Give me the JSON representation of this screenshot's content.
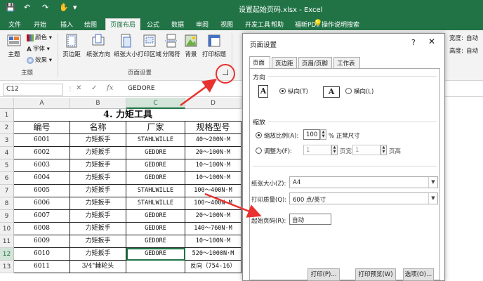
{
  "app": {
    "title": "设置起始页码.xlsx  -  Excel",
    "quick_access": [
      "💾",
      "↶",
      "↷",
      "✋",
      "▾"
    ]
  },
  "menu": {
    "tabs": [
      "文件",
      "开始",
      "插入",
      "绘图",
      "页面布局",
      "公式",
      "数据",
      "审阅",
      "视图",
      "开发工具",
      "帮助",
      "福昕PDF",
      "操作说明搜索"
    ],
    "active": "页面布局",
    "tell_me_icon": "lightbulb-icon"
  },
  "ribbon": {
    "theme_group": {
      "label": "主题",
      "main_button": "主题",
      "colors": "颜色",
      "fonts": "字体",
      "effects": "效果"
    },
    "page_setup_group": {
      "label": "页面设置",
      "buttons": [
        "页边距",
        "纸张方向",
        "纸张大小",
        "打印区域",
        "分隔符",
        "背景",
        "打印标题"
      ]
    },
    "scale_group": {
      "width_label": "宽度:",
      "width_value": "自动",
      "height_label": "高度:",
      "height_value": "自动"
    },
    "colors": {
      "accent": "#217346"
    }
  },
  "formula_bar": {
    "name_box": "C12",
    "cancel": "✕",
    "enter": "✓",
    "fx": "fx",
    "value": "GEDORE"
  },
  "sheet": {
    "columns": [
      "A",
      "B",
      "C",
      "D"
    ],
    "selected_column": "C",
    "row_numbers": [
      "1",
      "2",
      "3",
      "4",
      "5",
      "6",
      "7",
      "8",
      "9",
      "10",
      "11",
      "12",
      "13"
    ],
    "selected_row": "12",
    "title_cell": "4. 力矩工具",
    "headers": [
      "编号",
      "名称",
      "厂家",
      "规格型号"
    ],
    "rows": [
      [
        "6001",
        "力矩扳手",
        "STAHLWILLE",
        "40～200N·M"
      ],
      [
        "6002",
        "力矩扳手",
        "GEDORE",
        "20～100N·M"
      ],
      [
        "6003",
        "力矩扳手",
        "GEDORE",
        "10～100N·M"
      ],
      [
        "6004",
        "力矩扳手",
        "GEDORE",
        "10～100N·M"
      ],
      [
        "6005",
        "力矩扳手",
        "STAHLWILLE",
        "100～400N·M"
      ],
      [
        "6006",
        "力矩扳手",
        "STAHLWILLE",
        "100～400N·M"
      ],
      [
        "6007",
        "力矩扳手",
        "GEDORE",
        "20～100N·M"
      ],
      [
        "6008",
        "力矩扳手",
        "GEDORE",
        "140～760N·M"
      ],
      [
        "6009",
        "力矩扳手",
        "GEDORE",
        "10～100N·M"
      ],
      [
        "6010",
        "力矩扳手",
        "GEDORE",
        "520～1000N·M"
      ],
      [
        "6011",
        "3/4\"棘轮头",
        "",
        "反向（754-16）"
      ]
    ]
  },
  "dialog": {
    "title": "页面设置",
    "help": "?",
    "close": "✕",
    "tabs": [
      "页面",
      "页边距",
      "页眉/页脚",
      "工作表"
    ],
    "active_tab": "页面",
    "orientation": {
      "label": "方向",
      "portrait": "纵向(T)",
      "landscape": "横向(L)",
      "selected": "portrait"
    },
    "scaling": {
      "label": "缩放",
      "adjust_label": "缩放比例(A):",
      "adjust_value": "100",
      "adjust_unit": "% 正常尺寸",
      "fit_label": "调整为(F):",
      "fit_wide_value": "1",
      "fit_wide_unit": "页宽",
      "fit_tall_value": "1",
      "fit_tall_unit": "页高",
      "selected": "adjust"
    },
    "paper_size_label": "纸张大小(Z):",
    "paper_size_value": "A4",
    "print_quality_label": "打印质量(Q):",
    "print_quality_value": "600 点/英寸",
    "first_page_label": "起始页码(R):",
    "first_page_value": "自动",
    "buttons": [
      "打印(P)...",
      "打印预览(W)",
      "选项(O)..."
    ]
  },
  "annotations": {
    "color": "#e8322f"
  }
}
